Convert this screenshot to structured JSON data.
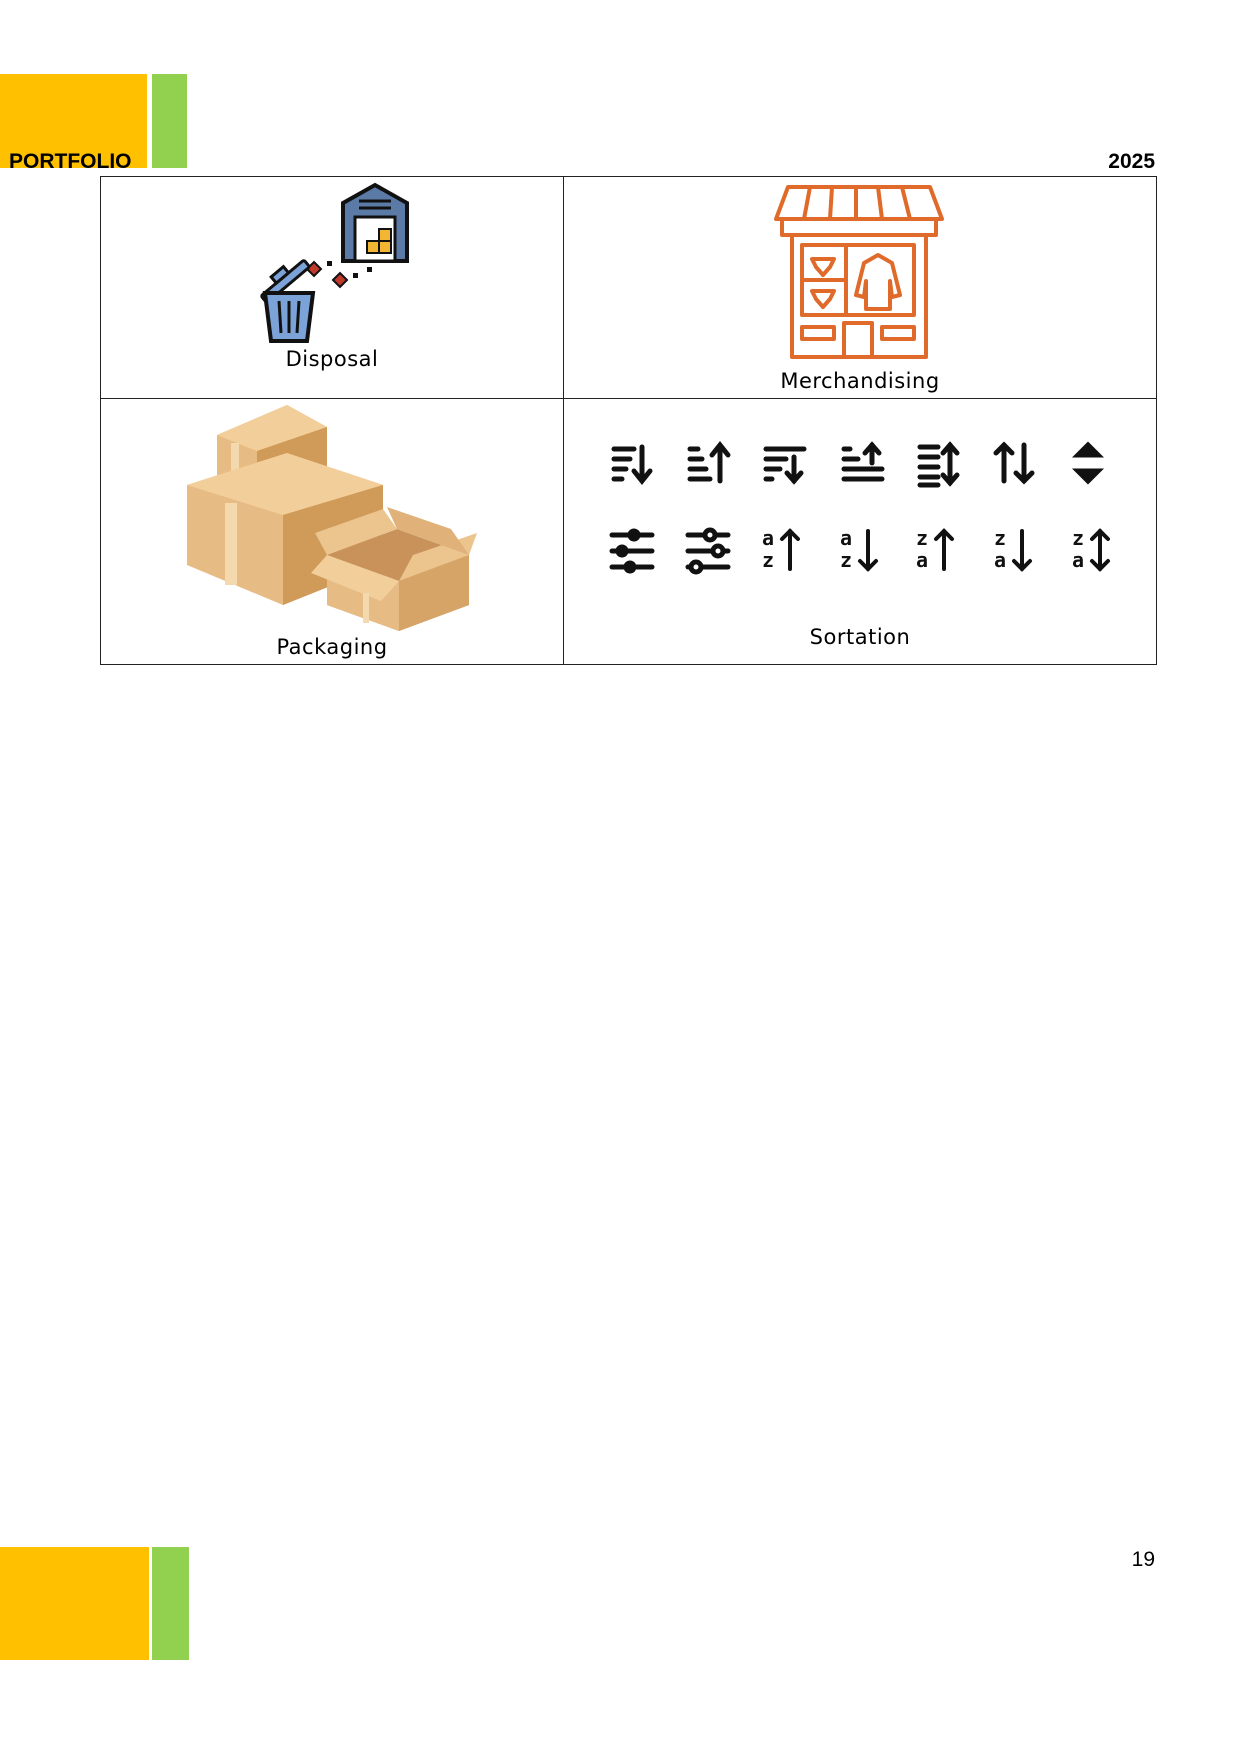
{
  "header": {
    "left_label": "PORTFOLIO",
    "right_label": "2025"
  },
  "colors": {
    "yellow": "#FFC000",
    "green": "#92D050",
    "warehouse": "#5B7BA6",
    "shop": "#E06A2A",
    "box": "#D9A466"
  },
  "cells": {
    "disposal": {
      "label": "Disposal",
      "icon": "disposal-trash-warehouse-icon"
    },
    "merchandising": {
      "label": "Merchandising",
      "icon": "storefront-icon"
    },
    "packaging": {
      "label": "Packaging",
      "icon": "cardboard-boxes-icon"
    },
    "sortation": {
      "label": "Sortation",
      "icons_row1": [
        "sort-desc-lines-icon",
        "sort-asc-lines-icon",
        "sort-desc-lines-alt-icon",
        "sort-asc-lines-alt-icon",
        "sort-both-lines-icon",
        "sort-arrows-up-down-icon",
        "sort-caret-up-down-icon"
      ],
      "icons_row2": [
        "sliders-filled-icon",
        "sliders-outline-icon",
        "sort-a-z-up-icon",
        "sort-a-z-down-icon",
        "sort-z-a-up-icon",
        "sort-z-a-down-icon",
        "sort-z-a-both-icon"
      ]
    }
  },
  "footer": {
    "page_number": "19"
  }
}
